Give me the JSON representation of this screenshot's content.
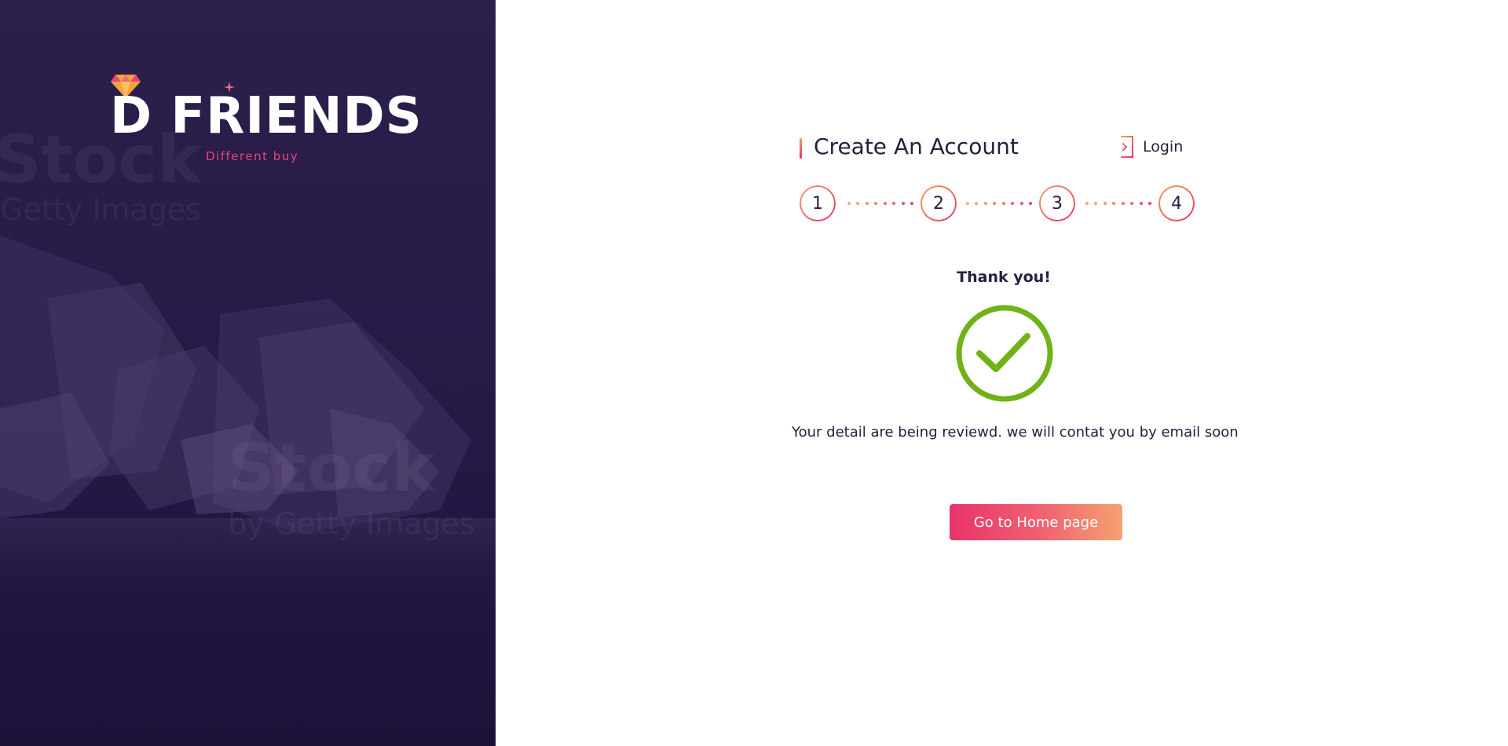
{
  "brand": {
    "name": "D FRIENDS",
    "tagline": "Different buy",
    "logo_icon": "diamond-icon",
    "accent_color": "#e8437a"
  },
  "header": {
    "title": "Create An Account",
    "login_label": "Login",
    "login_icon": "login-icon"
  },
  "stepper": {
    "steps": [
      "1",
      "2",
      "3",
      "4"
    ],
    "current_step": 4
  },
  "result": {
    "heading": "Thank you!",
    "icon": "check-circle-icon",
    "icon_color": "#6fb318",
    "message": "Your detail are being reviewd. we will contat you by email soon"
  },
  "actions": {
    "home_label": "Go to  Home page"
  },
  "colors": {
    "sidebar_bg": "#2a1d4a",
    "text": "#23213f",
    "gradient_start": "#e8336a",
    "gradient_end": "#f6a170"
  }
}
